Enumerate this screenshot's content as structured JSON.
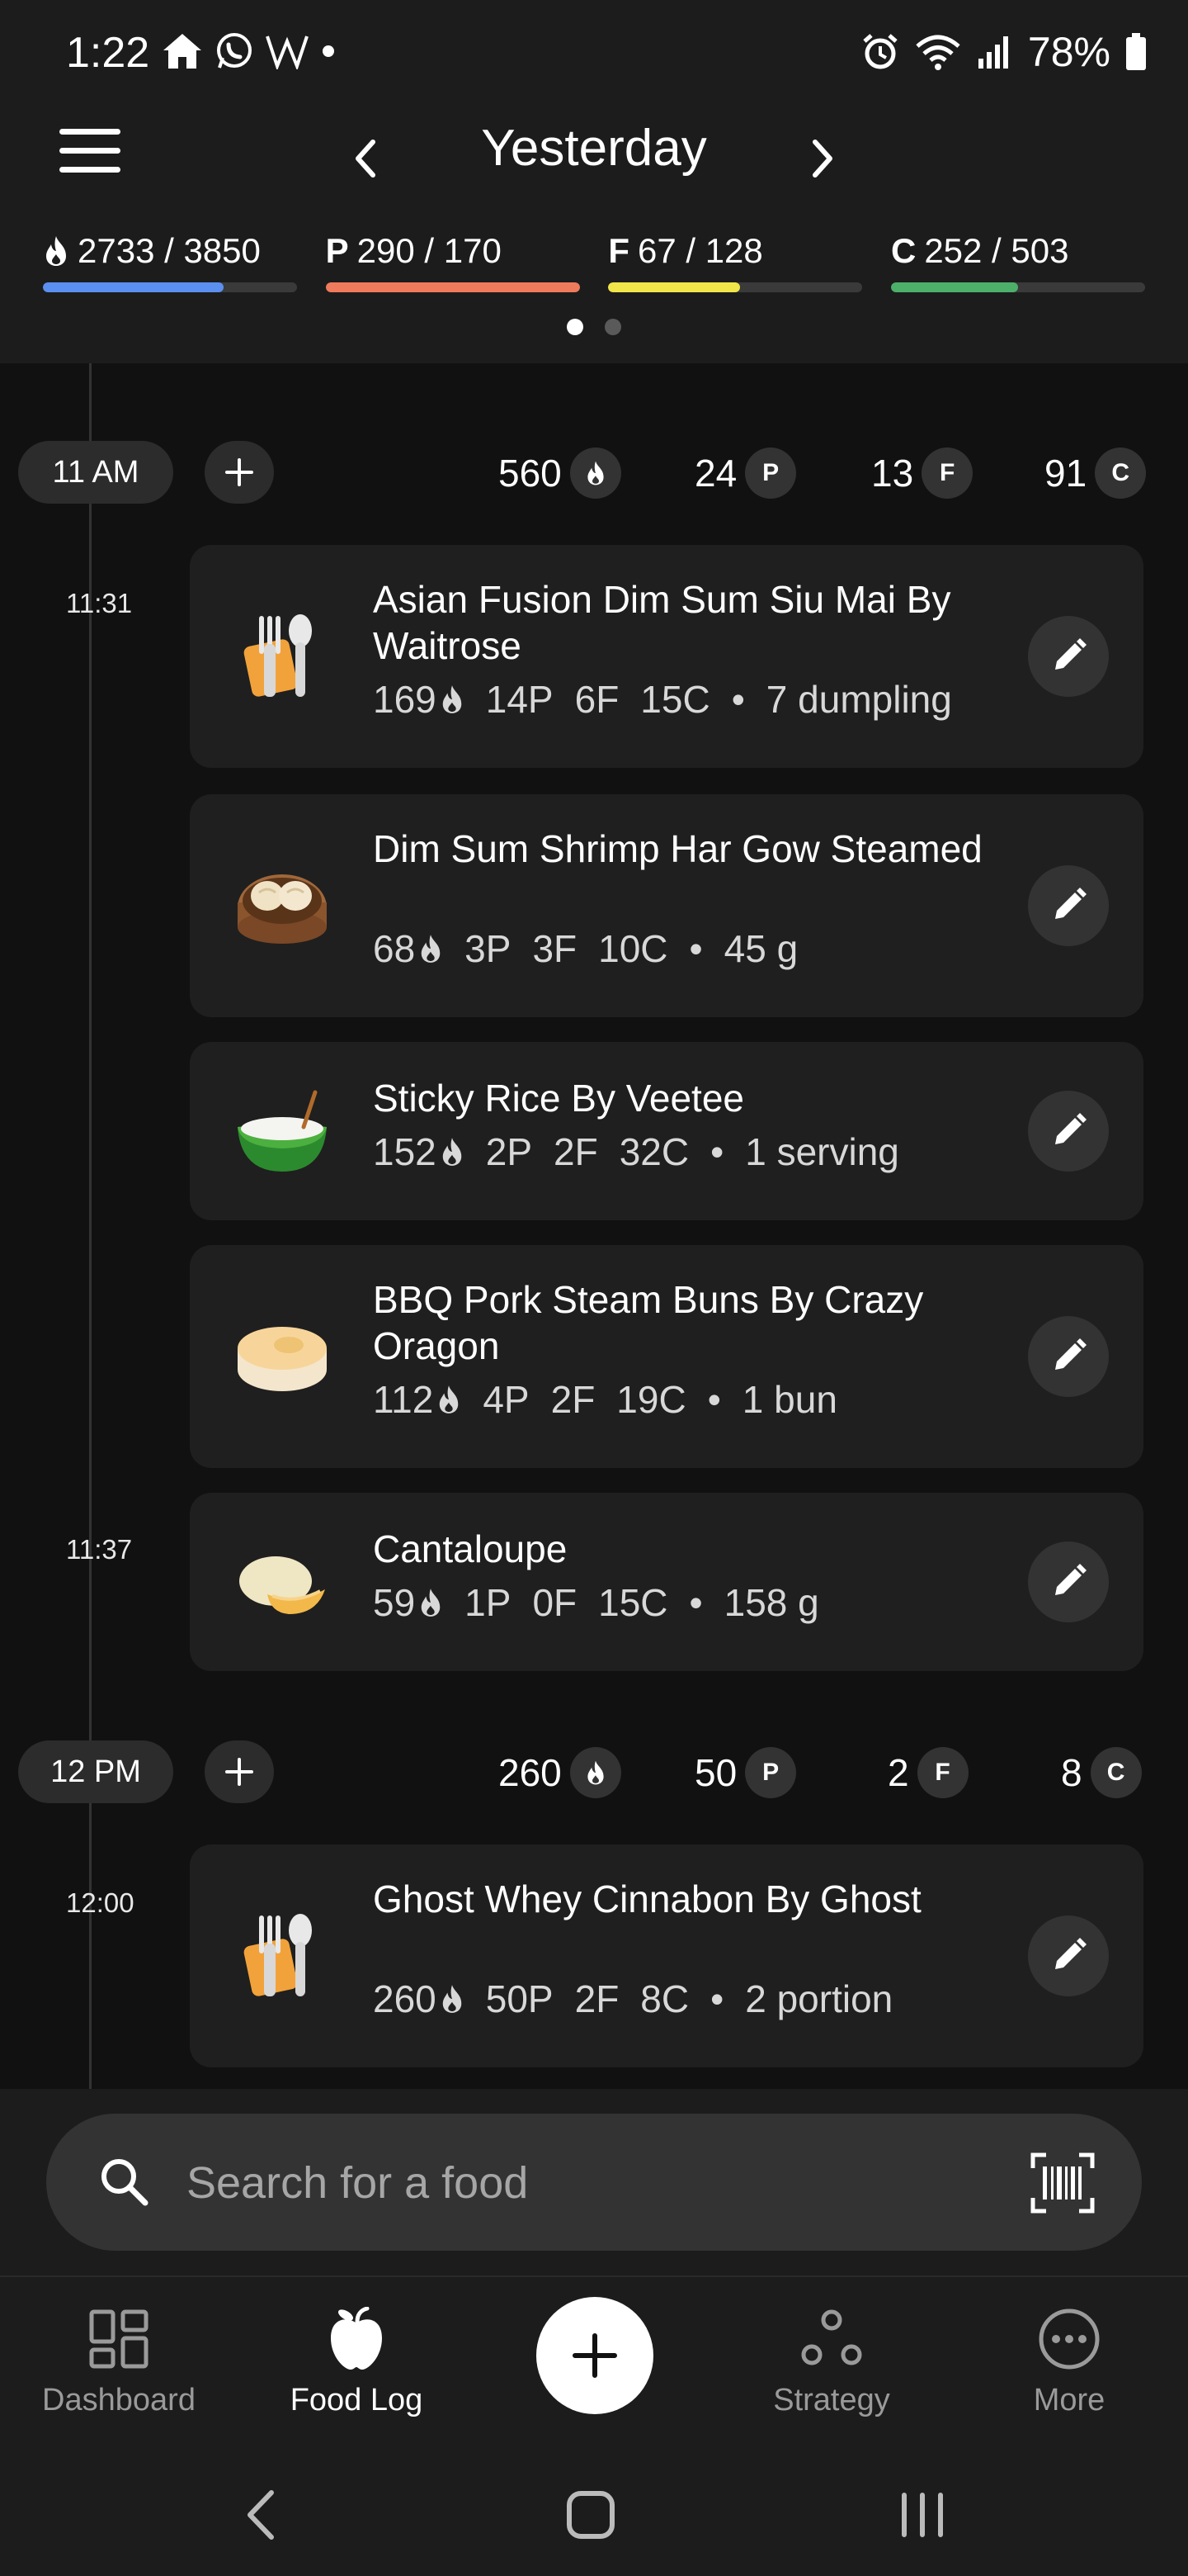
{
  "status_bar": {
    "time": "1:22",
    "battery": "78%",
    "icons": [
      "home-icon",
      "whatsapp-icon",
      "w-app-icon",
      "dot-icon",
      "alarm-icon",
      "wifi-icon",
      "signal-icon",
      "battery-icon"
    ]
  },
  "header": {
    "title": "Yesterday",
    "macros": [
      {
        "key": "cal",
        "letter": "",
        "icon": "flame-icon",
        "text": "2733 / 3850",
        "progress": 0.71,
        "color": "#5b8ff0"
      },
      {
        "key": "protein",
        "letter": "P",
        "text": "290 / 170",
        "progress": 1.0,
        "color": "#f07a5c"
      },
      {
        "key": "fat",
        "letter": "F",
        "text": "67 / 128",
        "progress": 0.52,
        "color": "#f0e64a"
      },
      {
        "key": "carbs",
        "letter": "C",
        "text": "252 / 503",
        "progress": 0.5,
        "color": "#4caf6a"
      }
    ],
    "page_dots": {
      "count": 2,
      "active": 0
    }
  },
  "groups": [
    {
      "hour": "11 AM",
      "calories": "560",
      "protein": "24",
      "fat": "13",
      "carbs": "91",
      "badges": {
        "p": "P",
        "f": "F",
        "c": "C"
      }
    },
    {
      "hour": "12 PM",
      "calories": "260",
      "protein": "50",
      "fat": "2",
      "carbs": "8",
      "badges": {
        "p": "P",
        "f": "F",
        "c": "C"
      }
    }
  ],
  "entries": [
    {
      "time": "11:31",
      "title": "Asian Fusion Dim Sum Siu Mai By Waitrose",
      "calories": "169",
      "protein": "14P",
      "fat": "6F",
      "carbs": "15C",
      "bullet": "•",
      "serving": "7 dumpling",
      "icon": "utensils-icon"
    },
    {
      "time": "",
      "title": "Dim Sum Shrimp Har Gow Steamed",
      "calories": "68",
      "protein": "3P",
      "fat": "3F",
      "carbs": "10C",
      "bullet": "•",
      "serving": "45 g",
      "icon": "dumpling-basket-icon"
    },
    {
      "time": "",
      "title": "Sticky Rice By Veetee",
      "calories": "152",
      "protein": "2P",
      "fat": "2F",
      "carbs": "32C",
      "bullet": "•",
      "serving": "1 serving",
      "icon": "rice-bowl-icon"
    },
    {
      "time": "",
      "title": "BBQ Pork Steam Buns By Crazy Oragon",
      "calories": "112",
      "protein": "4P",
      "fat": "2F",
      "carbs": "19C",
      "bullet": "•",
      "serving": "1 bun",
      "icon": "bun-icon"
    },
    {
      "time": "11:37",
      "title": "Cantaloupe",
      "calories": "59",
      "protein": "1P",
      "fat": "0F",
      "carbs": "15C",
      "bullet": "•",
      "serving": "158 g",
      "icon": "melon-icon"
    },
    {
      "time": "12:00",
      "title": "Ghost Whey Cinnabon By Ghost",
      "calories": "260",
      "protein": "50P",
      "fat": "2F",
      "carbs": "8C",
      "bullet": "•",
      "serving": "2 portion",
      "icon": "utensils-icon"
    }
  ],
  "search": {
    "placeholder": "Search for a food"
  },
  "bottom_nav": {
    "tabs": [
      {
        "label": "Dashboard",
        "icon": "dashboard-icon"
      },
      {
        "label": "Food Log",
        "icon": "apple-icon",
        "active": true
      },
      {
        "label": "Strategy",
        "icon": "strategy-icon"
      },
      {
        "label": "More",
        "icon": "more-icon"
      }
    ]
  }
}
